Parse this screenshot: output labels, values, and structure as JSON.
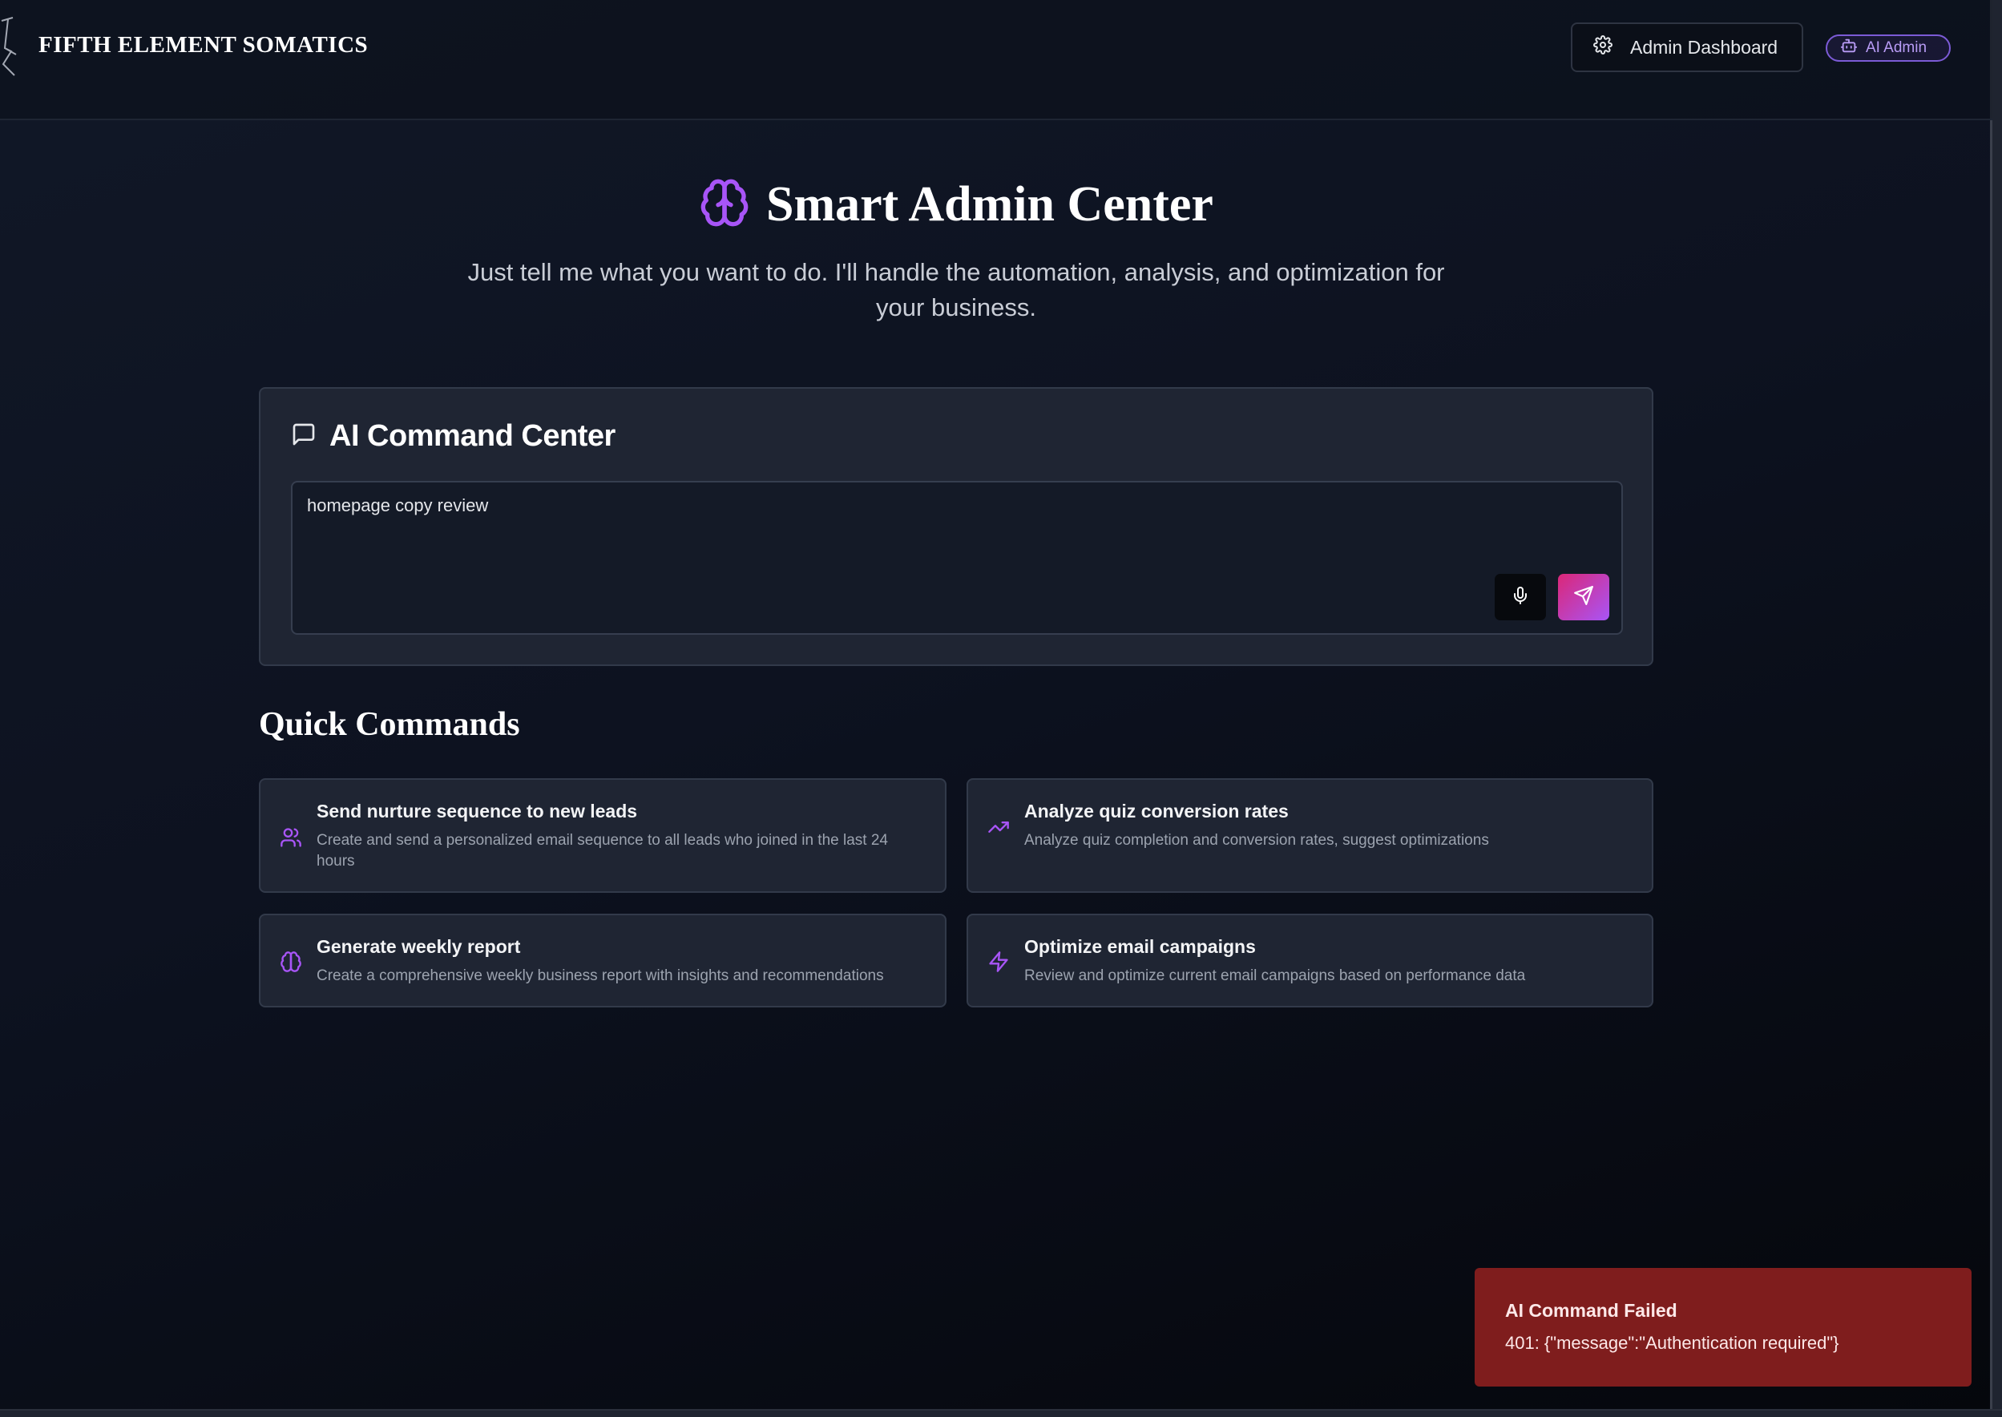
{
  "header": {
    "brand": "FIFTH ELEMENT SOMATICS",
    "admin_dashboard_label": "Admin Dashboard",
    "ai_admin_label": "AI Admin"
  },
  "hero": {
    "title": "Smart Admin Center",
    "subtitle": "Just tell me what you want to do. I'll handle the automation, analysis, and optimization for your business."
  },
  "command_center": {
    "title": "AI Command Center",
    "input_value": "homepage copy review"
  },
  "quick_commands": {
    "title": "Quick Commands",
    "items": [
      {
        "title": "Send nurture sequence to new leads",
        "description": "Create and send a personalized email sequence to all leads who joined in the last 24 hours",
        "icon": "users-icon"
      },
      {
        "title": "Analyze quiz conversion rates",
        "description": "Analyze quiz completion and conversion rates, suggest optimizations",
        "icon": "trending-up-icon"
      },
      {
        "title": "Generate weekly report",
        "description": "Create a comprehensive weekly business report with insights and recommendations",
        "icon": "brain-icon"
      },
      {
        "title": "Optimize email campaigns",
        "description": "Review and optimize current email campaigns based on performance data",
        "icon": "zap-icon"
      }
    ]
  },
  "toast": {
    "title": "AI Command Failed",
    "message": "401: {\"message\":\"Authentication required\"}"
  },
  "colors": {
    "accent_purple": "#a855f7",
    "send_gradient_start": "#db2777",
    "error_bg": "#7f1d1d",
    "card_bg": "#1f2533"
  }
}
